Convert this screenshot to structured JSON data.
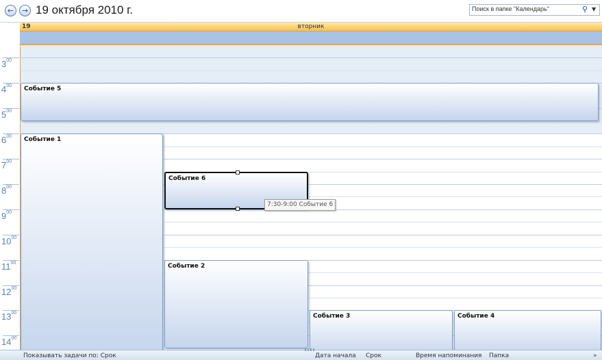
{
  "header": {
    "date_title": "19 октября 2010 г.",
    "search_placeholder": "Поиск в папке \"Календарь\""
  },
  "day": {
    "number": "19",
    "name": "вторник"
  },
  "hours": [
    "3",
    "4",
    "5",
    "6",
    "7",
    "8",
    "9",
    "10",
    "11",
    "12",
    "13",
    "14"
  ],
  "minutes_suffix": "00",
  "events": [
    {
      "title": "Событие 5",
      "start": 4.0,
      "end": 5.5,
      "col": 0,
      "cols": 1,
      "selected": false
    },
    {
      "title": "Событие 1",
      "start": 6.0,
      "end": 15.0,
      "col": 0,
      "cols": 4,
      "selected": false
    },
    {
      "title": "Событие 6",
      "start": 7.5,
      "end": 9.0,
      "col": 1,
      "cols": 4,
      "selected": true
    },
    {
      "title": "Событие 2",
      "start": 11.0,
      "end": 14.5,
      "col": 1,
      "cols": 4,
      "selected": false
    },
    {
      "title": "Событие 3",
      "start": 13.0,
      "end": 15.0,
      "col": 2,
      "cols": 4,
      "selected": false
    },
    {
      "title": "Событие 4",
      "start": 13.0,
      "end": 15.0,
      "col": 3,
      "cols": 4,
      "selected": false
    }
  ],
  "tooltip": "7:30-9:00 Событие 6",
  "bottombar": {
    "show_tasks": "Показывать задачи по: Срок",
    "start_date": "Дата начала",
    "due": "Срок",
    "reminder": "Время напоминания",
    "folder": "Папка"
  },
  "colors": {
    "day_header": "#f8c04d",
    "allday_bar": "#a9c3e6",
    "grid": "#e5edf7",
    "event_border": "#7f9ec9"
  }
}
